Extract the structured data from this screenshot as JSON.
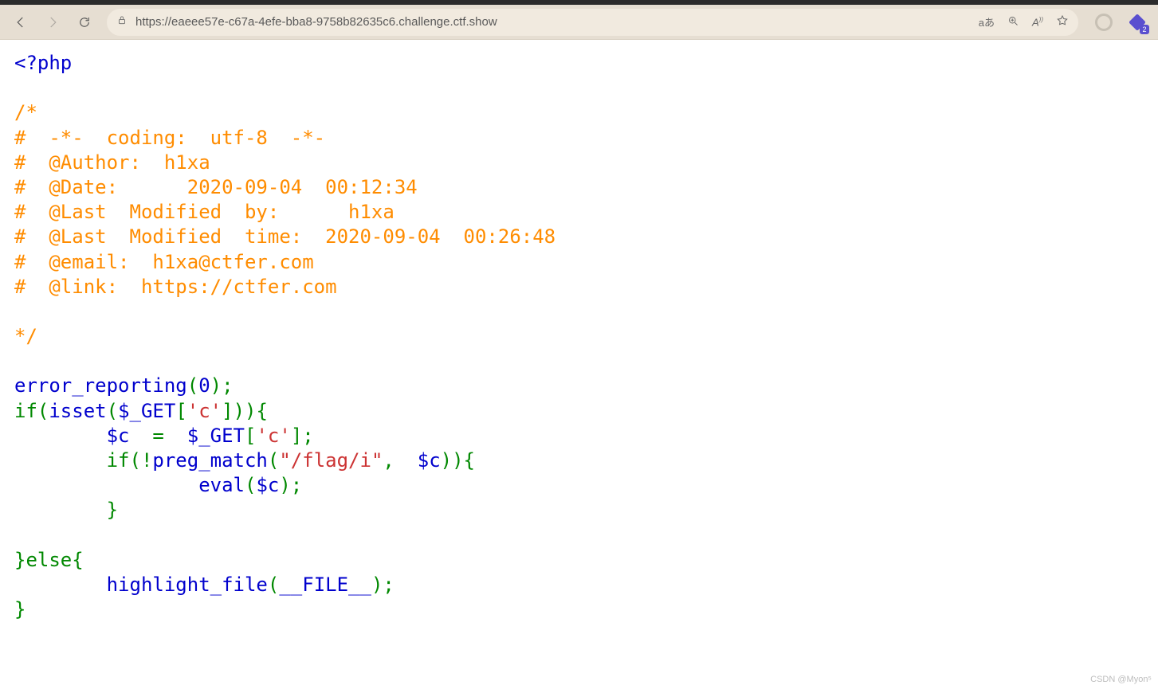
{
  "toolbar": {
    "url": "https://eaeee57e-c67a-4efe-bba8-9758b82635c6.challenge.ctf.show",
    "lang_indicator": "aあ",
    "ext_badge": "2"
  },
  "code": {
    "php_open": "<?php",
    "comment_open": "/*",
    "c1": "#  -*-  coding:  utf-8  -*-",
    "c2": "#  @Author:  h1xa",
    "c3": "#  @Date:      2020-09-04  00:12:34",
    "c4": "#  @Last  Modified  by:      h1xa",
    "c5": "#  @Last  Modified  time:  2020-09-04  00:26:48",
    "c6": "#  @email:  h1xa@ctfer.com",
    "c7": "#  @link:  https://ctfer.com",
    "comment_close": "*/",
    "fn_error_reporting": "error_reporting",
    "paren_o": "(",
    "zero": "0",
    "paren_c_semi": ");",
    "kw_if": "if(",
    "fn_isset": "isset",
    "dollar": "(",
    "var_get1": "$_GET",
    "brkt_o": "[",
    "str_c": "'c'",
    "brkt_c": "]",
    "pcc": ")){",
    "indent1": "        ",
    "var_c": "$c",
    "eq": "  =  ",
    "var_get2": "$_GET",
    "semi": ";",
    "kw_if2": "        if(!",
    "fn_preg": "preg_match",
    "str_regex": "\"/flag/i\"",
    "comma": ",  ",
    "pcc2": ")){",
    "indent2": "                ",
    "fn_eval": "eval",
    "close_brace_i": "        }",
    "brace_c": "}",
    "kw_else": "else{",
    "fn_highlight": "highlight_file",
    "const_file": "__FILE__",
    "close_final": "}"
  },
  "watermark": "CSDN @Myon⁵"
}
